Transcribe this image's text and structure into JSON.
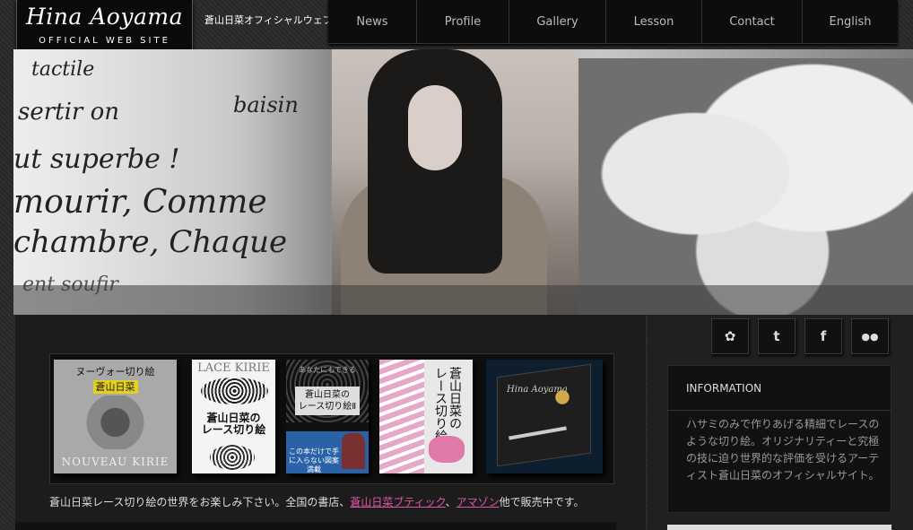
{
  "header": {
    "logo_name": "Hina Aoyama",
    "logo_sub": "OFFICIAL WEB SITE",
    "tagline": "蒼山日菜オフィシャルウェブサイト"
  },
  "nav": [
    {
      "label": "News"
    },
    {
      "label": "Profile"
    },
    {
      "label": "Gallery"
    },
    {
      "label": "Lesson"
    },
    {
      "label": "Contact"
    },
    {
      "label": "English"
    }
  ],
  "hero": {
    "script_lines": [
      "tactile",
      "sertir on",
      "baisin",
      "ut superbe !",
      "mourir, Comme",
      "chambre, Chaque",
      "ent soufir"
    ]
  },
  "books": [
    {
      "title": "ヌーヴォー切り絵",
      "author": "蒼山日菜",
      "bottom": "NOUVEAU KIRIE"
    },
    {
      "title": "LACE KIRIE",
      "main": "蒼山日菜の\nレース切り絵"
    },
    {
      "title": "あなたにもできる",
      "main": "蒼山日菜の\nレース切り絵Ⅱ",
      "footer": "この本だけで手に入らない図案満載"
    },
    {
      "vertical": "蒼山日菜の\nレース切り絵"
    },
    {
      "brand": "Hina Aoyama"
    }
  ],
  "caption": {
    "pre": "蒼山日菜レース切り絵の世界をお楽しみ下さい。全国の書店、",
    "link1": "蒼山日菜ブティック",
    "sep": "、",
    "link2": "アマゾン",
    "post": "他で販売中です。"
  },
  "social": [
    {
      "icon": "flower-icon",
      "glyph": "✿"
    },
    {
      "icon": "tumblr-icon",
      "glyph": "t"
    },
    {
      "icon": "facebook-icon",
      "glyph": "f"
    },
    {
      "icon": "flickr-icon",
      "glyph": "●●"
    }
  ],
  "info": {
    "heading": "INFORMATION",
    "body": "ハサミのみで作りあげる精細でレースのような切り絵。オリジナリティーと究極の技に迫り世界的な評価を受けるアーティスト蒼山日菜のオフィシャルサイト。"
  },
  "colors": {
    "link": "#d95aa0",
    "background": "#2b2b2b"
  }
}
